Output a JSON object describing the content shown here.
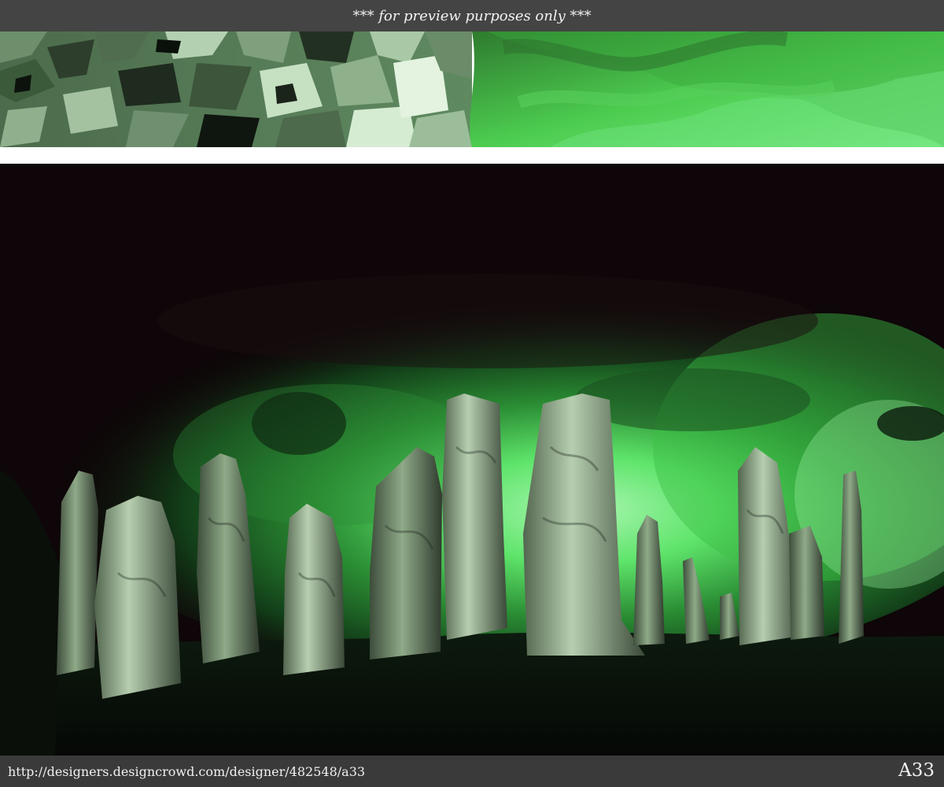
{
  "preview_notice": "*** for preview purposes only ***",
  "footer": {
    "url": "http://designers.designcrowd.com/designer/482548/a33",
    "code": "A33"
  },
  "colors": {
    "bar_dark": "#444444",
    "accent_green": "#4fd65a",
    "sky_dark": "#0e0608",
    "stone_green": "#7f9a78"
  },
  "images": {
    "banner": "abstract-green-camouflage-banner",
    "main": "standing-stones-under-green-sky"
  }
}
